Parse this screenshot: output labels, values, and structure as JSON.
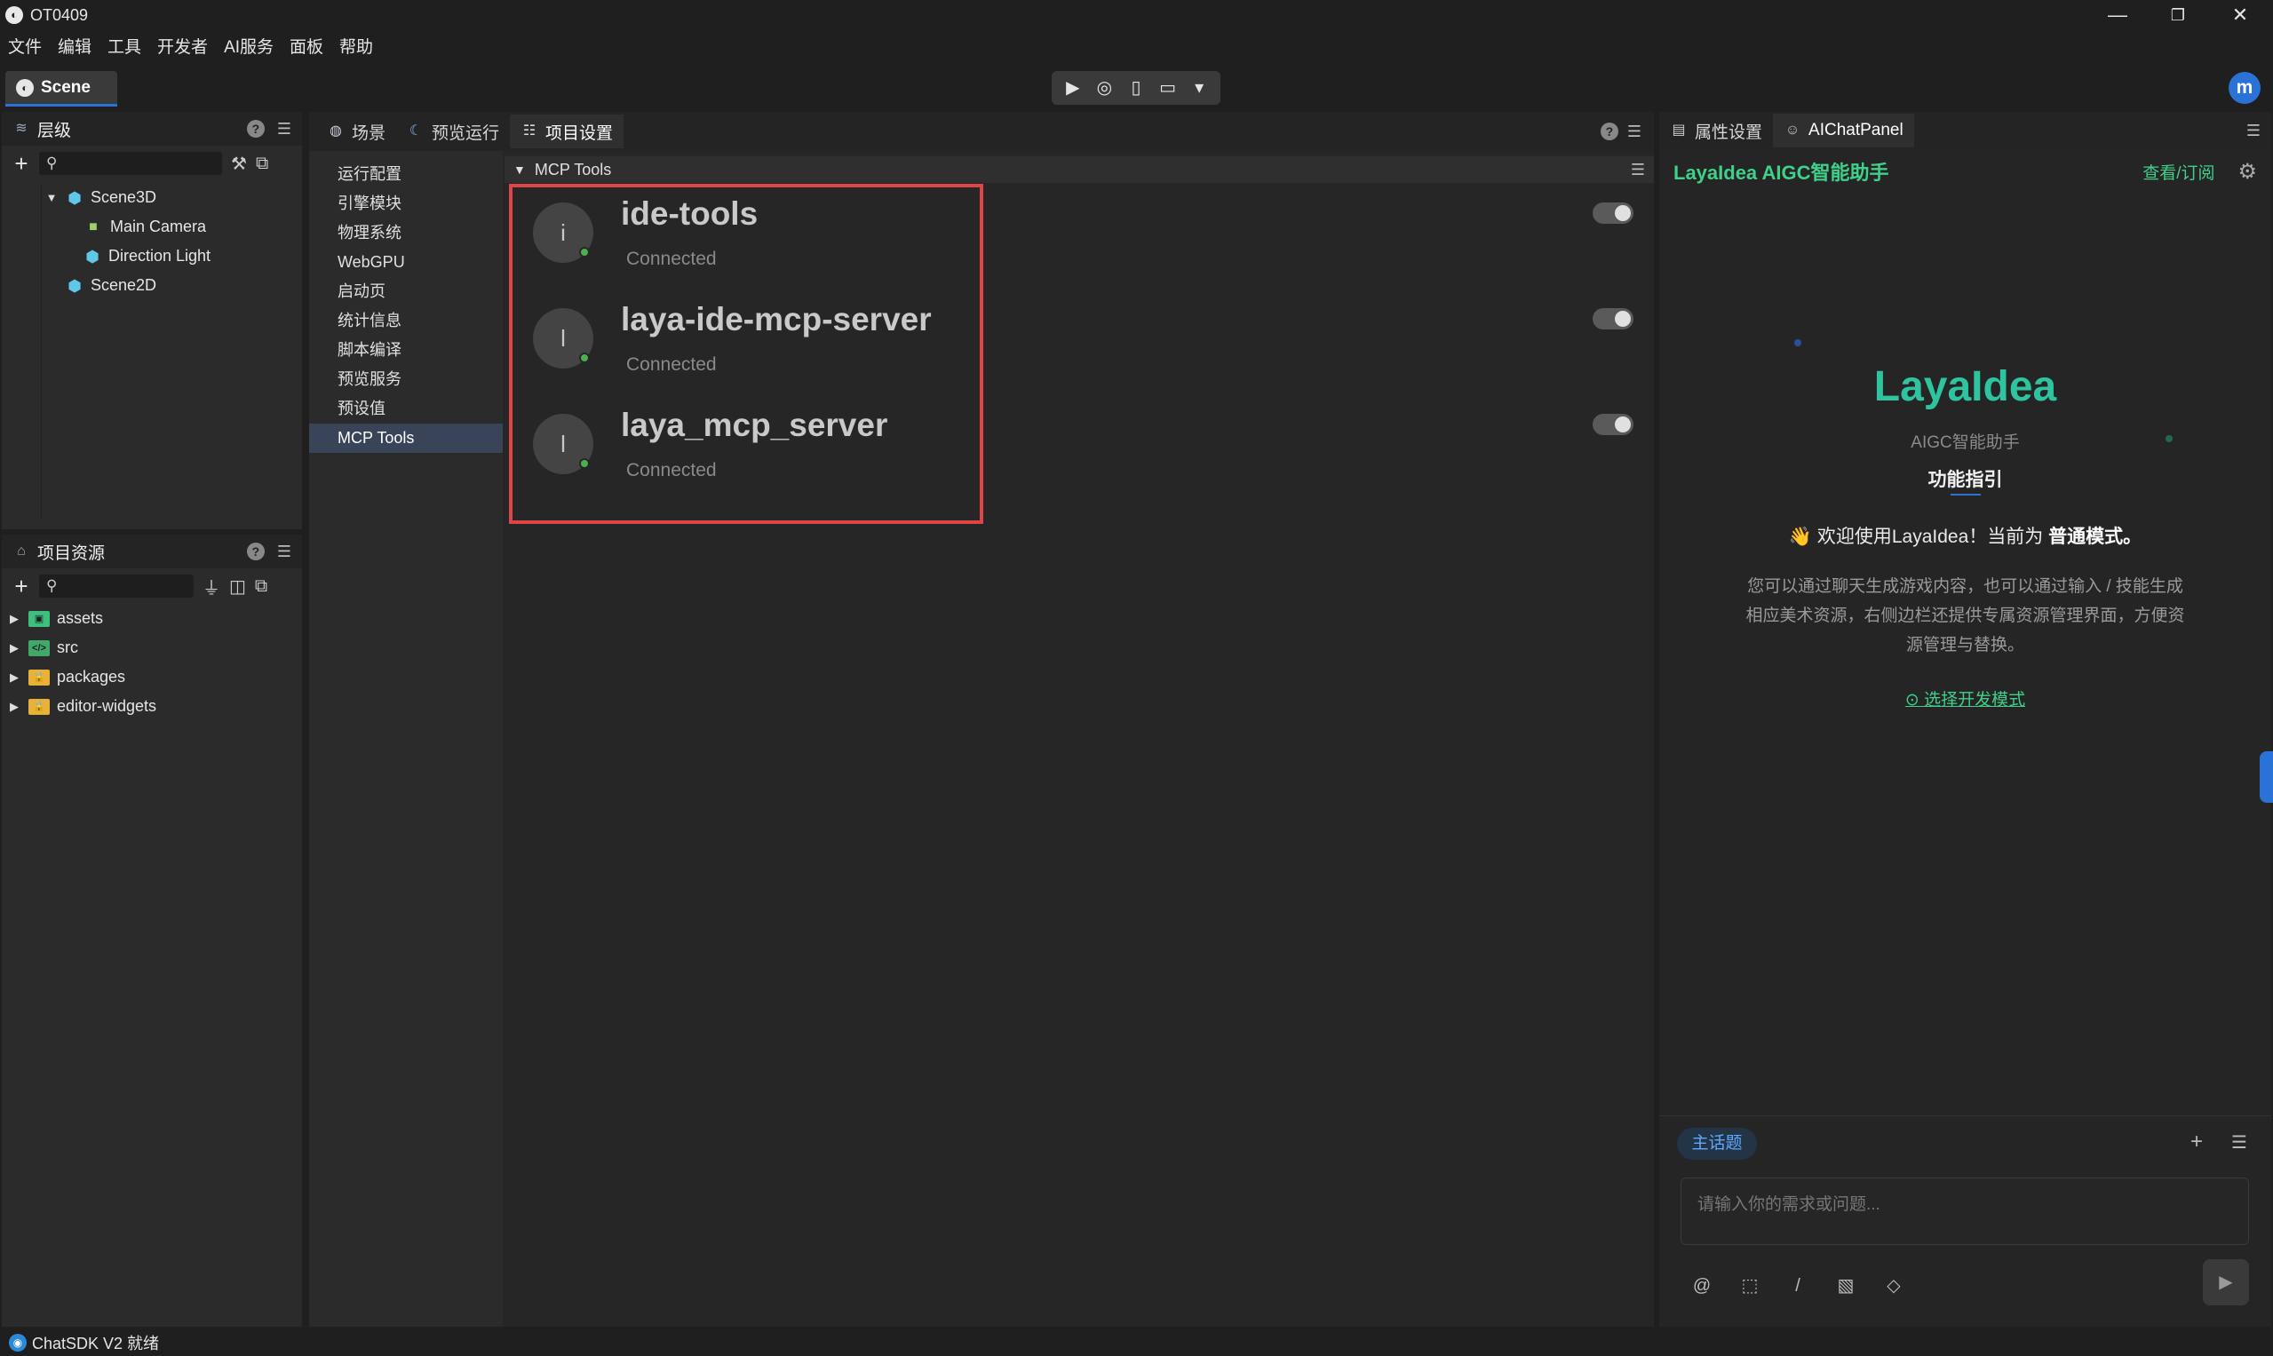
{
  "window": {
    "title": "OT0409",
    "minimize": "—",
    "restore": "❐",
    "close": "✕"
  },
  "menubar": [
    "文件",
    "编辑",
    "工具",
    "开发者",
    "AI服务",
    "面板",
    "帮助"
  ],
  "scene_tab": {
    "label": "Scene"
  },
  "user": {
    "initial": "m"
  },
  "hierarchy": {
    "title": "层级",
    "items": [
      {
        "label": "Scene3D",
        "expanded": true
      },
      {
        "label": "Main Camera"
      },
      {
        "label": "Direction Light"
      },
      {
        "label": "Scene2D"
      }
    ]
  },
  "resources": {
    "title": "项目资源",
    "items": [
      {
        "label": "assets"
      },
      {
        "label": "src"
      },
      {
        "label": "packages"
      },
      {
        "label": "editor-widgets"
      }
    ]
  },
  "center": {
    "tabs": [
      "场景",
      "预览运行",
      "项目设置"
    ],
    "active_tab": "项目设置",
    "nav": [
      "运行配置",
      "引擎模块",
      "物理系统",
      "WebGPU",
      "启动页",
      "统计信息",
      "脚本编译",
      "预览服务",
      "预设值",
      "MCP Tools"
    ],
    "active_nav": "MCP Tools",
    "section_title": "MCP Tools",
    "servers": [
      {
        "avatar": "i",
        "name": "ide-tools",
        "status": "Connected",
        "enabled": true
      },
      {
        "avatar": "l",
        "name": "laya-ide-mcp-server",
        "status": "Connected",
        "enabled": true
      },
      {
        "avatar": "l",
        "name": "laya_mcp_server",
        "status": "Connected",
        "enabled": true
      }
    ]
  },
  "right": {
    "tabs": [
      "属性设置",
      "AIChatPanel"
    ],
    "active_tab": "AIChatPanel",
    "header_title": "LayaIdea AIGC智能助手",
    "header_link": "查看/订阅",
    "brand": "LayaIdea",
    "brand_sub": "AIGC智能助手",
    "guide": "功能指引",
    "welcome_prefix": "👋 欢迎使用LayaIdea！当前为",
    "welcome_mode": "普通模式。",
    "description": "您可以通过聊天生成游戏内容，也可以通过输入 / 技能生成相应美术资源，右侧边栏还提供专属资源管理界面，方便资源管理与替换。",
    "mode_link": "⊙ 选择开发模式",
    "topic": "主话题",
    "input_placeholder": "请输入你的需求或问题..."
  },
  "status": {
    "text": "ChatSDK V2 就绪"
  },
  "colors": {
    "accent": "#2b72d6",
    "ai_green": "#3fd08a",
    "brand_teal": "#2fc4a0",
    "highlight": "#e04545",
    "connected": "#4caf50"
  }
}
